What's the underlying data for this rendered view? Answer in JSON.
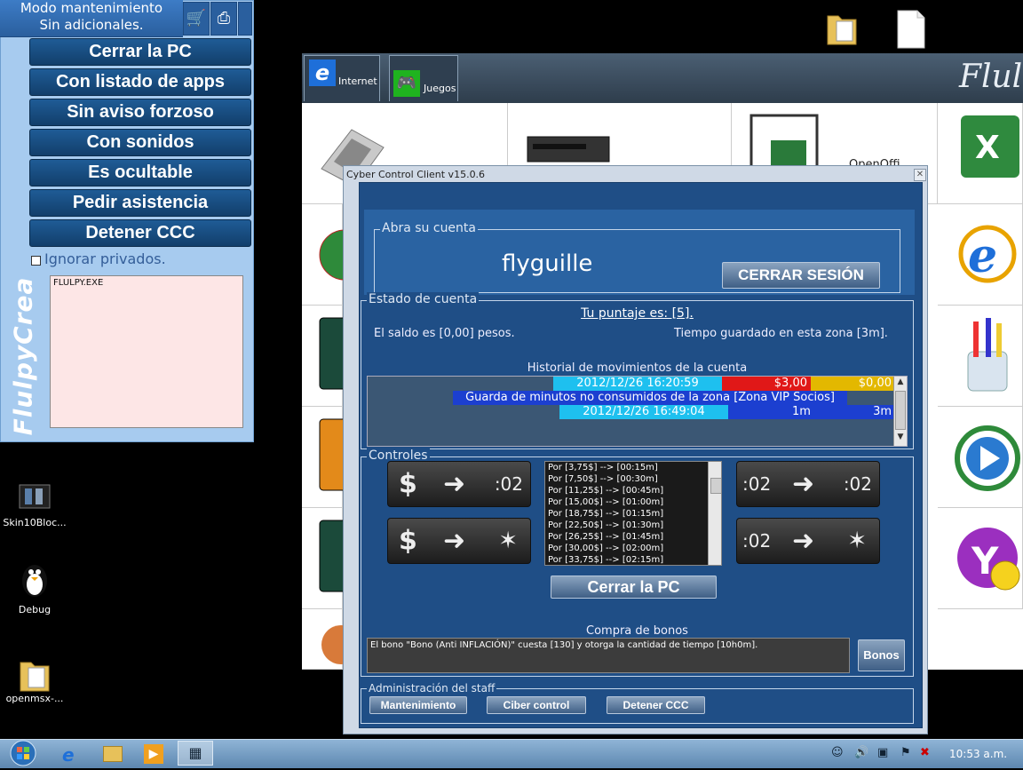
{
  "left_panel": {
    "mode_line1": "Modo mantenimiento",
    "mode_line2": "Sin adicionales.",
    "buttons": [
      "Cerrar la PC",
      "Con listado de apps",
      "Sin aviso forzoso",
      "Con sonidos",
      "Es ocultable",
      "Pedir asistencia",
      "Detener CCC"
    ],
    "ignore_private_label": "Ignorar privados.",
    "log_text": "FLULPY.EXE",
    "vertical_logo": "FlulpyCrea"
  },
  "desktop": {
    "icons": [
      "Skin10Bloc...",
      "Debug",
      "openmsx-..."
    ]
  },
  "launcher": {
    "tabs": [
      "Internet",
      "Juegos"
    ],
    "brand": "Flulp",
    "partial_label": "OpenOffi"
  },
  "dialog": {
    "title": "Cyber Control Client v15.0.6",
    "account_section": "Abra su cuenta",
    "username": "flyguille",
    "logout_button": "CERRAR SESIÓN",
    "status_section": "Estado de cuenta",
    "score": "Tu puntaje es: [5].",
    "balance": "El saldo es [0,00] pesos.",
    "saved_time": "Tiempo guardado en esta zona [3m].",
    "history_title": "Historial de movimientos de la cuenta",
    "history_row1_date": "2012/12/26 16:20:59",
    "history_row1_amount": "$3,00",
    "history_row1_balance": "$0,00",
    "history_row2_desc": "Guarda de minutos no consumidos de la zona [Zona VIP Socios]",
    "history_row3_date": "2012/12/26 16:49:04",
    "history_row3_minutes": "1m",
    "history_row3_total": "3m",
    "controls_section": "Controles",
    "ctl_time": ":02",
    "price_list": [
      "Por [3,75$] --> [00:15m]",
      "Por [7,50$] --> [00:30m]",
      "Por [11,25$] --> [00:45m]",
      "Por [15,00$] --> [01:00m]",
      "Por [18,75$] --> [01:15m]",
      "Por [22,50$] --> [01:30m]",
      "Por [26,25$] --> [01:45m]",
      "Por [30,00$] --> [02:00m]",
      "Por [33,75$] --> [02:15m]"
    ],
    "shutdown_button": "Cerrar la PC",
    "bonus_title": "Compra de bonos",
    "bonus_text": "El bono \"Bono (Anti INFLACIÓN)\" cuesta [130] y otorga la cantidad de tiempo [10h0m].",
    "bonus_button": "Bonos",
    "staff_section": "Administración del staff",
    "staff_buttons": [
      "Mantenimiento",
      "Ciber control",
      "Detener CCC"
    ]
  },
  "taskbar": {
    "clock": "10:53 a.m."
  }
}
